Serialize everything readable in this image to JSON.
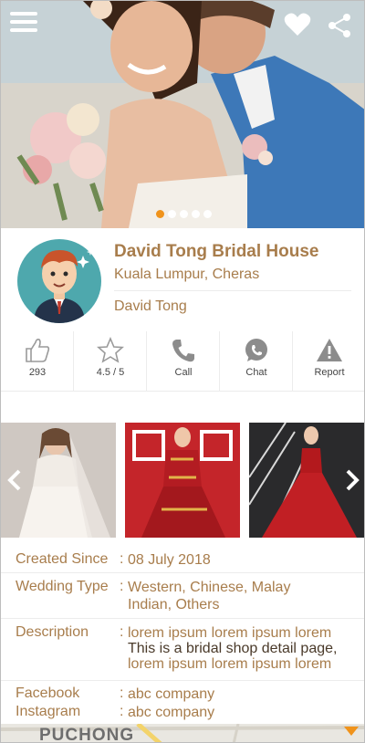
{
  "hero": {
    "menu_icon": "hamburger-menu-icon",
    "favorite_icon": "heart-icon",
    "share_icon": "share-icon",
    "dots_total": 5,
    "dots_active": 1
  },
  "profile": {
    "shop_name": "David Tong Bridal House",
    "location": "Kuala Lumpur, Cheras",
    "owner": "David Tong"
  },
  "actions": [
    {
      "label": "293",
      "icon": "thumbs-up-icon"
    },
    {
      "label": "4.5 / 5",
      "icon": "star-icon"
    },
    {
      "label": "Call",
      "icon": "phone-icon"
    },
    {
      "label": "Chat",
      "icon": "whatsapp-icon"
    },
    {
      "label": "Report",
      "icon": "warning-icon"
    }
  ],
  "details": {
    "created_since": {
      "label": "Created Since",
      "value": "08 July 2018"
    },
    "wedding_type": {
      "label": "Wedding Type",
      "value_line1": "Western, Chinese, Malay",
      "value_line2": "Indian, Others"
    },
    "description": {
      "label": "Description",
      "value_line1": "lorem ipsum lorem ipsum lorem",
      "value_line2": "This is a bridal shop detail page,",
      "value_line3": "lorem ipsum lorem ipsum lorem"
    },
    "facebook": {
      "label": "Facebook",
      "value": "abc company"
    },
    "instagram": {
      "label": "Instagram",
      "value": "abc company"
    },
    "colon": ":"
  },
  "map": {
    "label": "PUCHONG"
  },
  "colors": {
    "accent": "#a87d4c",
    "dot_active": "#f0931b",
    "avatar_bg": "#4ea8ad"
  }
}
